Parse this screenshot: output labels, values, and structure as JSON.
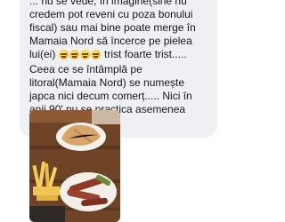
{
  "message": {
    "text_before_emoji": "... nu se vede, în imagine(sine nu credem pot reveni cu poza bonului fiscal) sau mai bine poate merge în Mamaia Nord să încerce pe pielea lui(ei) ",
    "emoji": [
      "persevere-face-icon",
      "persevere-face-icon",
      "persevere-face-icon",
      "persevere-face-icon"
    ],
    "text_after_emoji": " trist foarte trist..... Ceea ce se întâmplă pe litoral(Mamaia Nord) se numește japca nici decum comerț..... Nici în anii 90' nu se practica asemenea japca......"
  },
  "photo": {
    "subject": "food-plate-photo"
  },
  "colors": {
    "bubble": "#eef0f3",
    "text": "#15161a"
  }
}
